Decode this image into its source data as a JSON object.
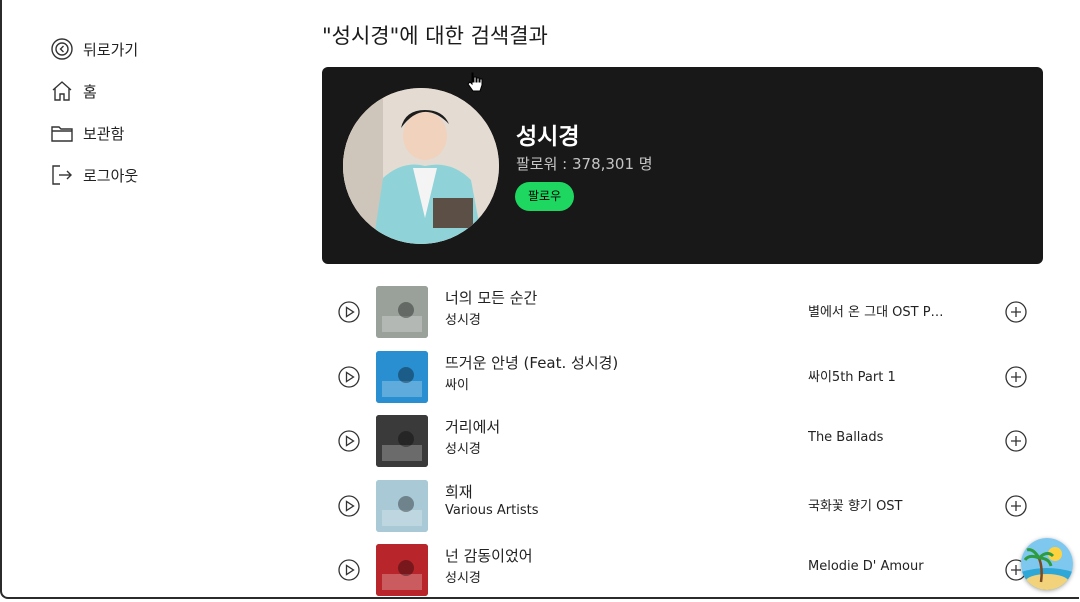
{
  "sidebar": {
    "items": [
      {
        "label": "뒤로가기",
        "icon": "back-circle-icon"
      },
      {
        "label": "홈",
        "icon": "home-icon"
      },
      {
        "label": "보관함",
        "icon": "folder-icon"
      },
      {
        "label": "로그아웃",
        "icon": "logout-icon"
      }
    ]
  },
  "search": {
    "title": "\"성시경\"에 대한 검색결과"
  },
  "artist": {
    "name": "성시경",
    "followers": "팔로워 : 378,301 명",
    "follow_label": "팔로우"
  },
  "songs": [
    {
      "title": "너의 모든 순간",
      "artist": "성시경",
      "album": "별에서 온 그대 OST P…",
      "cover_color": "#9aa19b"
    },
    {
      "title": "뜨거운 안녕 (Feat. 성시경)",
      "artist": "싸이",
      "album": "싸이5th Part 1",
      "cover_color": "#2a8fd1"
    },
    {
      "title": "거리에서",
      "artist": "성시경",
      "album": "The Ballads",
      "cover_color": "#3a3a3a"
    },
    {
      "title": "희재",
      "artist": "Various Artists",
      "album": "국화꽃 향기 OST",
      "cover_color": "#a9c9d6"
    },
    {
      "title": "넌 감동이었어",
      "artist": "성시경",
      "album": "Melodie D' Amour",
      "cover_color": "#b8262b"
    }
  ],
  "colors": {
    "card_bg": "#181818",
    "accent": "#1ed760"
  }
}
